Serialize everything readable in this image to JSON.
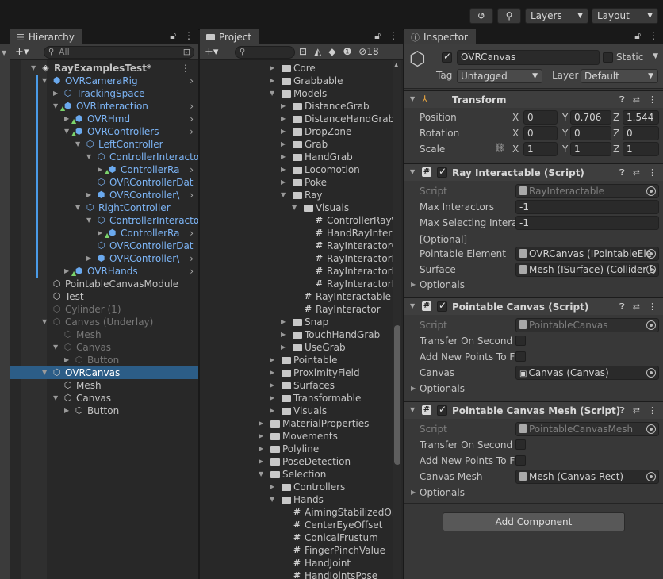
{
  "topbar": {
    "history_icon": "history-icon",
    "search_icon": "search-icon",
    "layers_label": "Layers",
    "layout_label": "Layout"
  },
  "hierarchy": {
    "tab_label": "Hierarchy",
    "search_placeholder": "All",
    "items": [
      {
        "label": "RayExamplesTest*",
        "depth": 0,
        "icon": "unity-scene-icon",
        "arrow": "down",
        "kind": "scene"
      },
      {
        "label": "OVRCameraRig",
        "depth": 1,
        "icon": "prefab-icon",
        "arrow": "down",
        "kind": "prefab",
        "chev": true
      },
      {
        "label": "TrackingSpace",
        "depth": 2,
        "icon": "gameobject-icon",
        "arrow": "right",
        "kind": "prefab-child"
      },
      {
        "label": "OVRInteraction",
        "depth": 2,
        "icon": "prefab-variant-icon",
        "arrow": "down",
        "kind": "prefab",
        "chev": true
      },
      {
        "label": "OVRHmd",
        "depth": 3,
        "icon": "prefab-variant-icon",
        "arrow": "right",
        "kind": "prefab",
        "chev": true
      },
      {
        "label": "OVRControllers",
        "depth": 3,
        "icon": "prefab-variant-icon",
        "arrow": "down",
        "kind": "prefab",
        "chev": true
      },
      {
        "label": "LeftController",
        "depth": 4,
        "icon": "gameobject-icon",
        "arrow": "down",
        "kind": "prefab-child"
      },
      {
        "label": "ControllerInteracto",
        "depth": 5,
        "icon": "gameobject-icon",
        "arrow": "down",
        "kind": "prefab-child"
      },
      {
        "label": "ControllerRa",
        "depth": 6,
        "icon": "prefab-variant-icon",
        "arrow": "right",
        "kind": "prefab",
        "chev": true
      },
      {
        "label": "OVRControllerDat",
        "depth": 5,
        "icon": "gameobject-icon",
        "arrow": "none",
        "kind": "prefab-child"
      },
      {
        "label": "OVRController\\",
        "depth": 5,
        "icon": "prefab-icon",
        "arrow": "right",
        "kind": "prefab",
        "chev": true
      },
      {
        "label": "RightController",
        "depth": 4,
        "icon": "gameobject-icon",
        "arrow": "down",
        "kind": "prefab-child"
      },
      {
        "label": "ControllerInteracto",
        "depth": 5,
        "icon": "gameobject-icon",
        "arrow": "down",
        "kind": "prefab-child"
      },
      {
        "label": "ControllerRa",
        "depth": 6,
        "icon": "prefab-variant-icon",
        "arrow": "right",
        "kind": "prefab",
        "chev": true
      },
      {
        "label": "OVRControllerDat",
        "depth": 5,
        "icon": "gameobject-icon",
        "arrow": "none",
        "kind": "prefab-child"
      },
      {
        "label": "OVRController\\",
        "depth": 5,
        "icon": "prefab-icon",
        "arrow": "right",
        "kind": "prefab",
        "chev": true
      },
      {
        "label": "OVRHands",
        "depth": 3,
        "icon": "prefab-variant-icon",
        "arrow": "right",
        "kind": "prefab",
        "chev": true
      },
      {
        "label": "PointableCanvasModule",
        "depth": 1,
        "icon": "gameobject-icon",
        "arrow": "none",
        "kind": "normal"
      },
      {
        "label": "Test",
        "depth": 1,
        "icon": "gameobject-icon",
        "arrow": "none",
        "kind": "normal"
      },
      {
        "label": "Cylinder (1)",
        "depth": 1,
        "icon": "gameobject-icon",
        "arrow": "none",
        "kind": "dim"
      },
      {
        "label": "Canvas (Underlay)",
        "depth": 1,
        "icon": "gameobject-icon",
        "arrow": "down",
        "kind": "dim"
      },
      {
        "label": "Mesh",
        "depth": 2,
        "icon": "gameobject-icon",
        "arrow": "none",
        "kind": "dim"
      },
      {
        "label": "Canvas",
        "depth": 2,
        "icon": "gameobject-icon",
        "arrow": "down",
        "kind": "dim"
      },
      {
        "label": "Button",
        "depth": 3,
        "icon": "gameobject-icon",
        "arrow": "right",
        "kind": "dim"
      },
      {
        "label": "OVRCanvas",
        "depth": 1,
        "icon": "gameobject-icon",
        "arrow": "down",
        "kind": "selected"
      },
      {
        "label": "Mesh",
        "depth": 2,
        "icon": "gameobject-icon",
        "arrow": "none",
        "kind": "normal"
      },
      {
        "label": "Canvas",
        "depth": 2,
        "icon": "gameobject-icon",
        "arrow": "down",
        "kind": "normal"
      },
      {
        "label": "Button",
        "depth": 3,
        "icon": "gameobject-icon",
        "arrow": "right",
        "kind": "normal"
      }
    ]
  },
  "project": {
    "tab_label": "Project",
    "hidden_count": "18",
    "items": [
      {
        "label": "Core",
        "depth": 2,
        "type": "folder",
        "arrow": "right"
      },
      {
        "label": "Grabbable",
        "depth": 2,
        "type": "folder",
        "arrow": "right"
      },
      {
        "label": "Models",
        "depth": 2,
        "type": "folder",
        "arrow": "down"
      },
      {
        "label": "DistanceGrab",
        "depth": 3,
        "type": "folder",
        "arrow": "right"
      },
      {
        "label": "DistanceHandGrab",
        "depth": 3,
        "type": "folder",
        "arrow": "right"
      },
      {
        "label": "DropZone",
        "depth": 3,
        "type": "folder",
        "arrow": "right"
      },
      {
        "label": "Grab",
        "depth": 3,
        "type": "folder",
        "arrow": "right"
      },
      {
        "label": "HandGrab",
        "depth": 3,
        "type": "folder",
        "arrow": "right"
      },
      {
        "label": "Locomotion",
        "depth": 3,
        "type": "folder",
        "arrow": "right"
      },
      {
        "label": "Poke",
        "depth": 3,
        "type": "folder",
        "arrow": "right"
      },
      {
        "label": "Ray",
        "depth": 3,
        "type": "folder",
        "arrow": "down"
      },
      {
        "label": "Visuals",
        "depth": 4,
        "type": "folder",
        "arrow": "down"
      },
      {
        "label": "ControllerRay\\",
        "depth": 5,
        "type": "script",
        "arrow": "none"
      },
      {
        "label": "HandRayIntera",
        "depth": 5,
        "type": "script",
        "arrow": "none"
      },
      {
        "label": "RayInteractorC",
        "depth": 5,
        "type": "script",
        "arrow": "none"
      },
      {
        "label": "RayInteractorD",
        "depth": 5,
        "type": "script",
        "arrow": "none"
      },
      {
        "label": "RayInteractorD",
        "depth": 5,
        "type": "script",
        "arrow": "none"
      },
      {
        "label": "RayInteractorP",
        "depth": 5,
        "type": "script",
        "arrow": "none"
      },
      {
        "label": "RayInteractable",
        "depth": 4,
        "type": "script",
        "arrow": "none"
      },
      {
        "label": "RayInteractor",
        "depth": 4,
        "type": "script",
        "arrow": "none"
      },
      {
        "label": "Snap",
        "depth": 3,
        "type": "folder",
        "arrow": "right"
      },
      {
        "label": "TouchHandGrab",
        "depth": 3,
        "type": "folder",
        "arrow": "right"
      },
      {
        "label": "UseGrab",
        "depth": 3,
        "type": "folder",
        "arrow": "right"
      },
      {
        "label": "Pointable",
        "depth": 2,
        "type": "folder",
        "arrow": "right"
      },
      {
        "label": "ProximityField",
        "depth": 2,
        "type": "folder",
        "arrow": "right"
      },
      {
        "label": "Surfaces",
        "depth": 2,
        "type": "folder",
        "arrow": "right"
      },
      {
        "label": "Transformable",
        "depth": 2,
        "type": "folder",
        "arrow": "right"
      },
      {
        "label": "Visuals",
        "depth": 2,
        "type": "folder",
        "arrow": "right"
      },
      {
        "label": "MaterialProperties",
        "depth": 1,
        "type": "folder",
        "arrow": "right"
      },
      {
        "label": "Movements",
        "depth": 1,
        "type": "folder",
        "arrow": "right"
      },
      {
        "label": "Polyline",
        "depth": 1,
        "type": "folder",
        "arrow": "right"
      },
      {
        "label": "PoseDetection",
        "depth": 1,
        "type": "folder",
        "arrow": "right"
      },
      {
        "label": "Selection",
        "depth": 1,
        "type": "folder",
        "arrow": "down"
      },
      {
        "label": "Controllers",
        "depth": 2,
        "type": "folder",
        "arrow": "right"
      },
      {
        "label": "Hands",
        "depth": 2,
        "type": "folder",
        "arrow": "down"
      },
      {
        "label": "AimingStabilizedOri",
        "depth": 3,
        "type": "script",
        "arrow": "none"
      },
      {
        "label": "CenterEyeOffset",
        "depth": 3,
        "type": "script",
        "arrow": "none"
      },
      {
        "label": "ConicalFrustum",
        "depth": 3,
        "type": "script",
        "arrow": "none"
      },
      {
        "label": "FingerPinchValue",
        "depth": 3,
        "type": "script",
        "arrow": "none"
      },
      {
        "label": "HandJoint",
        "depth": 3,
        "type": "script",
        "arrow": "none"
      },
      {
        "label": "HandJointsPose",
        "depth": 3,
        "type": "script",
        "arrow": "none"
      }
    ]
  },
  "inspector": {
    "tab_label": "Inspector",
    "object_name": "OVRCanvas",
    "static_label": "Static",
    "tag_label": "Tag",
    "tag_value": "Untagged",
    "layer_label": "Layer",
    "layer_value": "Default",
    "transform": {
      "title": "Transform",
      "position_label": "Position",
      "rotation_label": "Rotation",
      "scale_label": "Scale",
      "x_label": "X",
      "y_label": "Y",
      "z_label": "Z",
      "position": {
        "x": "0",
        "y": "0.706",
        "z": "1.544"
      },
      "rotation": {
        "x": "0",
        "y": "0",
        "z": "0"
      },
      "scale": {
        "x": "1",
        "y": "1",
        "z": "1"
      }
    },
    "ray_interactable": {
      "title": "Ray Interactable (Script)",
      "script_label": "Script",
      "script_value": "RayInteractable",
      "max_interactors_label": "Max Interactors",
      "max_interactors_value": "-1",
      "max_selecting_label": "Max Selecting Interac",
      "max_selecting_value": "-1",
      "optional_header": "[Optional]",
      "pointable_element_label": "Pointable Element",
      "pointable_element_value": "OVRCanvas (IPointableEle",
      "surface_label": "Surface",
      "surface_value": "Mesh (ISurface) (Collider S",
      "optionals_label": "Optionals"
    },
    "pointable_canvas": {
      "title": "Pointable Canvas (Script)",
      "script_label": "Script",
      "script_value": "PointableCanvas",
      "transfer_label": "Transfer On Second S",
      "add_points_label": "Add New Points To Fi",
      "canvas_label": "Canvas",
      "canvas_value": "Canvas (Canvas)",
      "optionals_label": "Optionals"
    },
    "pointable_canvas_mesh": {
      "title": "Pointable Canvas Mesh (Script)",
      "script_label": "Script",
      "script_value": "PointableCanvasMesh",
      "transfer_label": "Transfer On Second S",
      "add_points_label": "Add New Points To Fi",
      "canvas_mesh_label": "Canvas Mesh",
      "canvas_mesh_value": "Mesh (Canvas Rect)",
      "optionals_label": "Optionals"
    },
    "add_component_label": "Add Component"
  }
}
